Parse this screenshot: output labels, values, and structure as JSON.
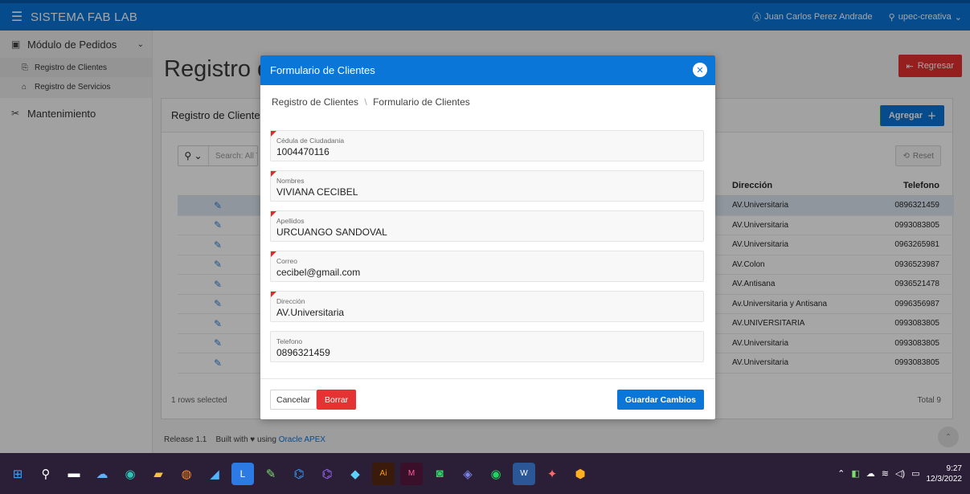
{
  "topbar": {
    "app_title": "SISTEMA FAB LAB",
    "user_name": "Juan Carlos Perez Andrade",
    "workspace": "upec-creativa"
  },
  "sidebar": {
    "items": [
      {
        "label": "Módulo de Pedidos",
        "icon": "orders-icon"
      },
      {
        "label": "Mantenimiento",
        "icon": "tools-icon"
      }
    ],
    "sub_items": [
      {
        "label": "Registro de Clientes",
        "icon": "clients-icon",
        "active": true
      },
      {
        "label": "Registro de Servicios",
        "icon": "services-icon",
        "active": false
      }
    ]
  },
  "main": {
    "page_title": "Registro de Clientes",
    "back_label": "Regresar",
    "region_title": "Registro de Clientes",
    "add_label": "Agregar",
    "search_placeholder": "Search: All Text Columns",
    "reset_label": "Reset",
    "columns": {
      "direccion": "Dirección",
      "telefono": "Telefono"
    },
    "rows": [
      {
        "direccion": "AV.Universitaria",
        "telefono": "0896321459",
        "selected": true
      },
      {
        "direccion": "AV.Universitaria",
        "telefono": "0993083805",
        "selected": false
      },
      {
        "direccion": "AV.Universitaria",
        "telefono": "0963265981",
        "selected": false
      },
      {
        "direccion": "AV.Colon",
        "telefono": "0936523987",
        "selected": false
      },
      {
        "direccion": "AV.Antisana",
        "telefono": "0936521478",
        "selected": false
      },
      {
        "direccion": "Av.Universitaria y Antisana",
        "telefono": "0996356987",
        "selected": false
      },
      {
        "direccion": "AV.UNIVERSITARIA",
        "telefono": "0993083805",
        "selected": false
      },
      {
        "direccion": "AV.Universitaria",
        "telefono": "0993083805",
        "selected": false
      },
      {
        "direccion": "AV.Universitaria",
        "telefono": "0993083805",
        "selected": false
      }
    ],
    "rows_selected": "1 rows selected",
    "total": "Total 9"
  },
  "footer": {
    "release": "Release 1.1",
    "built_with": "Built with",
    "using": "using",
    "apex_link": "Oracle APEX"
  },
  "dialog": {
    "title": "Formulario de Clientes",
    "breadcrumb_parent": "Registro de Clientes",
    "breadcrumb_separator": "\\",
    "breadcrumb_current": "Formulario de Clientes",
    "fields": [
      {
        "label": "Cédula de Ciudadania",
        "value": "1004470116",
        "required": true
      },
      {
        "label": "Nombres",
        "value": "VIVIANA CECIBEL",
        "required": true
      },
      {
        "label": "Apellidos",
        "value": "URCUANGO SANDOVAL",
        "required": true
      },
      {
        "label": "Correo",
        "value": "cecibel@gmail.com",
        "required": true
      },
      {
        "label": "Dirección",
        "value": "AV.Universitaria",
        "required": true
      },
      {
        "label": "Telefono",
        "value": "0896321459",
        "required": false
      }
    ],
    "cancel_label": "Cancelar",
    "delete_label": "Borrar",
    "save_label": "Guardar Cambios"
  },
  "taskbar": {
    "time": "9:27",
    "date": "12/3/2022"
  },
  "colors": {
    "accent": "#0a76d8",
    "danger": "#e52e2e",
    "success": "#29a829"
  }
}
